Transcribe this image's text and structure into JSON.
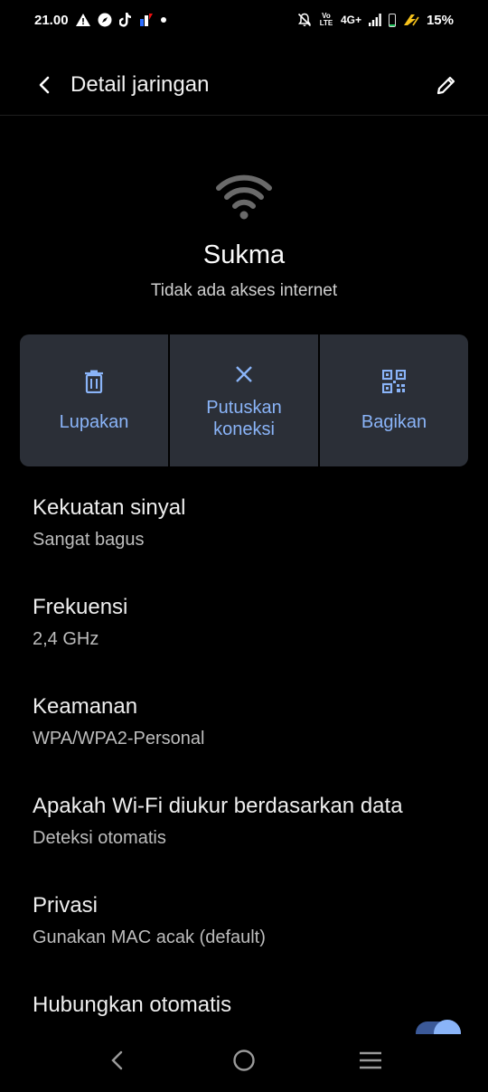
{
  "status_bar": {
    "time": "21.00",
    "network_label": "4G+",
    "volte_label": "Vo LTE",
    "battery": "15%",
    "battery_fill": 0.15
  },
  "app_bar": {
    "title": "Detail jaringan"
  },
  "network": {
    "name": "Sukma",
    "status": "Tidak ada akses internet"
  },
  "actions": [
    {
      "label": "Lupakan",
      "icon": "trash-icon"
    },
    {
      "label_line1": "Putuskan",
      "label_line2": "koneksi",
      "icon": "close-icon"
    },
    {
      "label": "Bagikan",
      "icon": "qr-code-icon"
    }
  ],
  "details": [
    {
      "title": "Kekuatan sinyal",
      "value": "Sangat bagus"
    },
    {
      "title": "Frekuensi",
      "value": "2,4 GHz"
    },
    {
      "title": "Keamanan",
      "value": "WPA/WPA2-Personal"
    },
    {
      "title": "Apakah Wi-Fi diukur berdasarkan data",
      "value": "Deteksi otomatis"
    },
    {
      "title": "Privasi",
      "value": "Gunakan MAC acak (default)"
    },
    {
      "title": "Hubungkan otomatis"
    }
  ],
  "colors": {
    "accent": "#8ab4f8",
    "card_bg": "#2b2f37",
    "background": "#000000"
  }
}
